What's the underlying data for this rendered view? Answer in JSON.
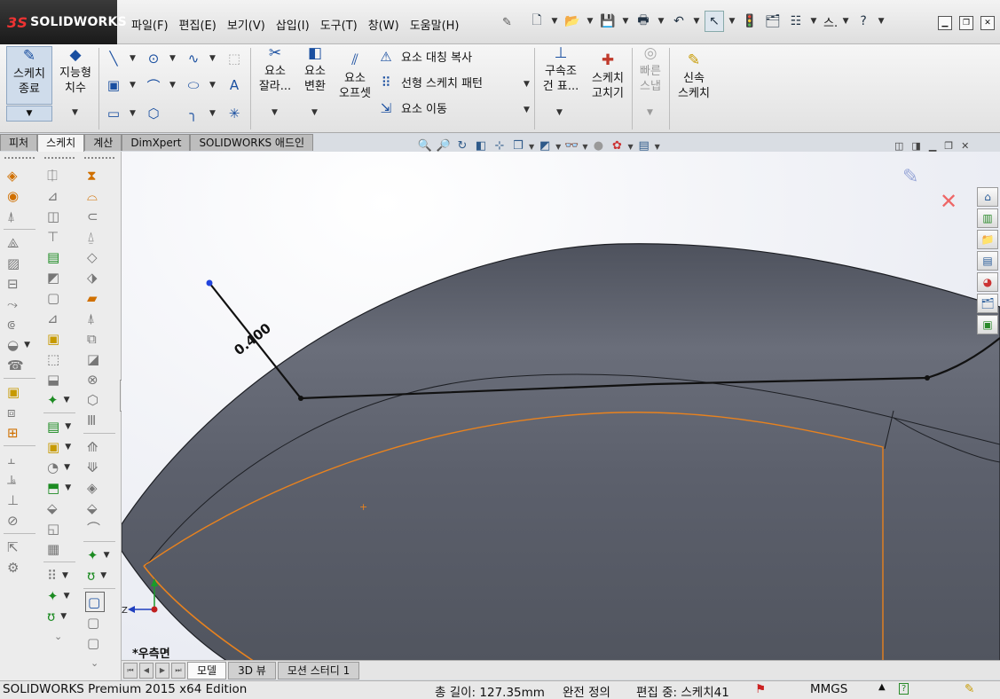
{
  "app": {
    "logo_text": "SOLIDWORKS",
    "logo_mark": "3S"
  },
  "menus": [
    "파일(F)",
    "편집(E)",
    "보기(V)",
    "삽입(I)",
    "도구(T)",
    "창(W)",
    "도움말(H)"
  ],
  "quickbar": {
    "search_label": "스.",
    "icons": [
      "new-document-icon",
      "open-folder-icon",
      "save-icon",
      "print-icon",
      "undo-icon",
      "select-pointer-icon",
      "traffic-light-icon",
      "file-properties-icon",
      "options-icon"
    ]
  },
  "ribbon": {
    "exit_sketch": "스케치\n종료",
    "smart_dimension": "지능형\n치수",
    "trim": "요소\n잘라...",
    "convert": "요소\n변환",
    "offset": "요소\n오프셋",
    "mirror": "요소 대칭 복사",
    "linear_pattern": "선형 스케치 패턴",
    "move": "요소 이동",
    "relations": "구속조\n건 표...",
    "repair": "스케치\n고치기",
    "quick_snap": "빠른\n스냅",
    "rapid_sketch": "신속\n스케치"
  },
  "tabs": [
    "피처",
    "스케치",
    "계산",
    "DimXpert",
    "SOLIDWORKS 애드인"
  ],
  "active_tab": "스케치",
  "graphics": {
    "dimension_value": "0.400",
    "view_label": "*우측면",
    "triad_axis": "Z",
    "colors": {
      "body": "#5b5f6c",
      "sketch": "#111111",
      "highlight": "#e8821e",
      "endpoint": "#2244dd"
    }
  },
  "doc_tabs": [
    "모델",
    "3D 뷰",
    "모션 스터디 1"
  ],
  "active_doc_tab": "모델",
  "status": {
    "edition": "SOLIDWORKS Premium 2015 x64 Edition",
    "length": "총 길이: 127.35mm",
    "definition": "완전 정의",
    "editing": "편집 중: 스케치41",
    "units": "MMGS"
  }
}
